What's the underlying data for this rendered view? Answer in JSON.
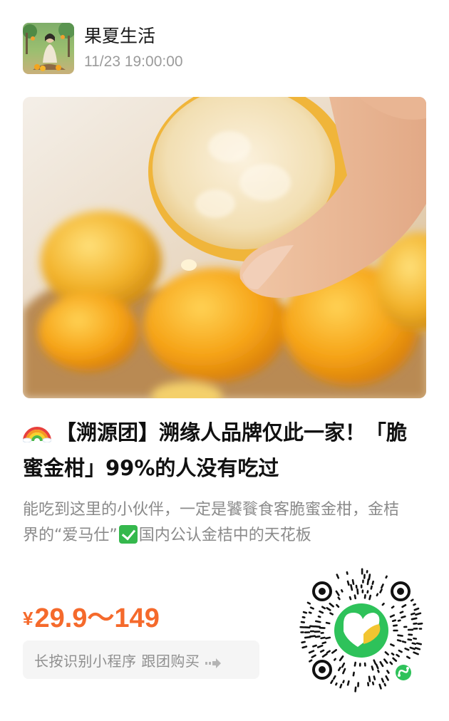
{
  "header": {
    "shop_name": "果夏生活",
    "post_time": "11/23 19:00:00"
  },
  "hero": {
    "image_subject": "hand squeezing a halved kumquat over a basket of golden kumquats"
  },
  "post": {
    "title_icon": "rainbow-icon",
    "title": "【溯源团】溯缘人品牌仅此一家！「脆蜜金柑」99%的人没有吃过",
    "desc_before": "能吃到这里的小伙伴，一定是饕餮食客脆蜜金柑，金桔界的“爱马仕”",
    "desc_icon": "check-icon",
    "desc_after": "国内公认金桔中的天花板"
  },
  "price": {
    "currency": "¥",
    "amount": "29.9～149"
  },
  "cta": {
    "label": "长按识别小程序  跟团购买",
    "icon": "arrow-right-icon"
  },
  "qr": {
    "icon": "mini-program-qr-code",
    "badge_icon": "mini-program-link-icon"
  },
  "colors": {
    "price": "#f56a2c",
    "qr_center": "#2ec25a",
    "logo_accent": "#f2c531"
  }
}
